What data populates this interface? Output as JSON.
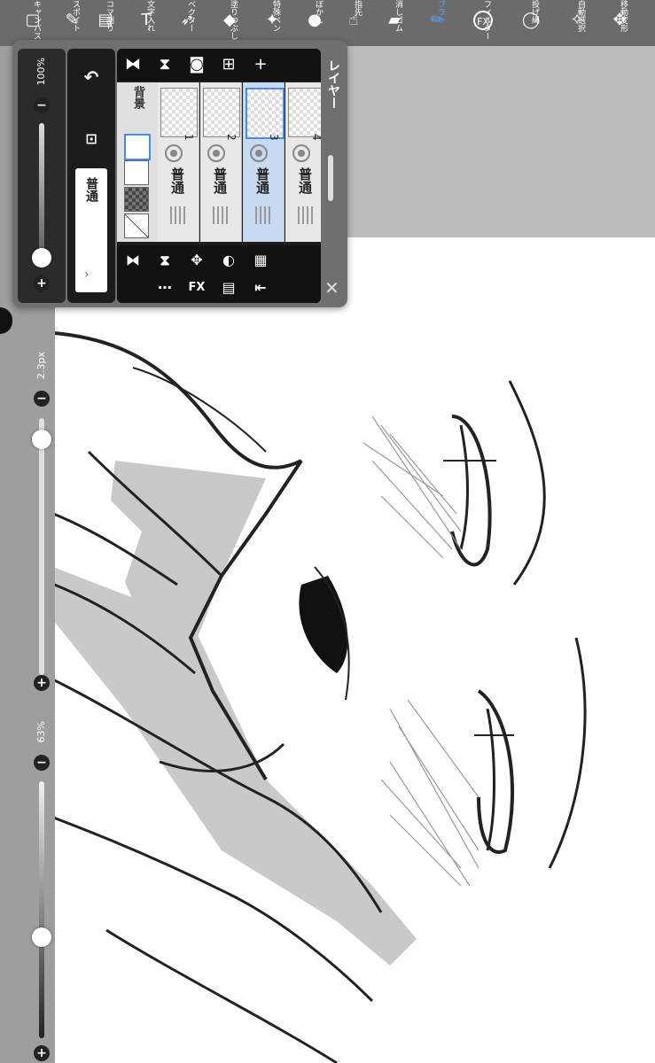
{
  "toolbar": {
    "tools": [
      {
        "id": "canvas",
        "label": "キャンバス",
        "icon": "square-icon",
        "glyph": "▢"
      },
      {
        "id": "eyedropper",
        "label": "スポイト",
        "icon": "eyedropper-icon",
        "glyph": "✎"
      },
      {
        "id": "frame",
        "label": "コマ割り",
        "icon": "frame-icon",
        "glyph": "▤"
      },
      {
        "id": "text",
        "label": "文字入れ",
        "icon": "text-icon",
        "glyph": "T"
      },
      {
        "id": "vector",
        "label": "ベクター",
        "icon": "vector-icon",
        "glyph": "➶"
      },
      {
        "id": "fill",
        "label": "塗りつぶし",
        "icon": "fill-icon",
        "glyph": "◆"
      },
      {
        "id": "special-pen",
        "label": "特殊ペン",
        "icon": "special-pen-icon",
        "glyph": "✦"
      },
      {
        "id": "blur",
        "label": "ぼかし",
        "icon": "blur-icon",
        "glyph": "●"
      },
      {
        "id": "smudge",
        "label": "指先",
        "icon": "smudge-icon",
        "glyph": "☝"
      },
      {
        "id": "eraser",
        "label": "消しゴム",
        "icon": "eraser-icon",
        "glyph": "▰"
      },
      {
        "id": "brush",
        "label": "ブラシ",
        "icon": "brush-icon",
        "glyph": "✏"
      },
      {
        "id": "filter",
        "label": "フィルター",
        "icon": "fx-icon",
        "glyph": "FX"
      },
      {
        "id": "lasso",
        "label": "投げ縄",
        "icon": "lasso-icon",
        "glyph": "◯"
      },
      {
        "id": "magic-wand",
        "label": "自動選択",
        "icon": "magic-wand-icon",
        "glyph": "✧"
      },
      {
        "id": "move",
        "label": "移動変形",
        "icon": "move-icon",
        "glyph": "✥"
      }
    ],
    "active_tool": "brush",
    "active_color": "#5aa0ff"
  },
  "left_rail": {
    "brush_size": "2.3px",
    "brush_size_fraction": 0.03,
    "brush_opacity": "63%",
    "brush_opacity_fraction": 0.63
  },
  "layer_panel": {
    "title": "レイヤー",
    "layer_opacity": "100%",
    "layer_opacity_fraction": 1.0,
    "blend_mode_button": "普通",
    "background_label": "背景",
    "layers": [
      {
        "number": "1",
        "blend": "普通",
        "selected": false
      },
      {
        "number": "2",
        "blend": "普通",
        "selected": false
      },
      {
        "number": "3",
        "blend": "普通",
        "selected": true
      },
      {
        "number": "4",
        "blend": "普通",
        "selected": false
      }
    ],
    "fx_label": "FX"
  },
  "colors": {
    "toolbar_bg": "#6b6b6b",
    "panel_bg": "#1c1c1c",
    "selected_layer": "#c8daf2",
    "accent": "#4a8ae8"
  }
}
